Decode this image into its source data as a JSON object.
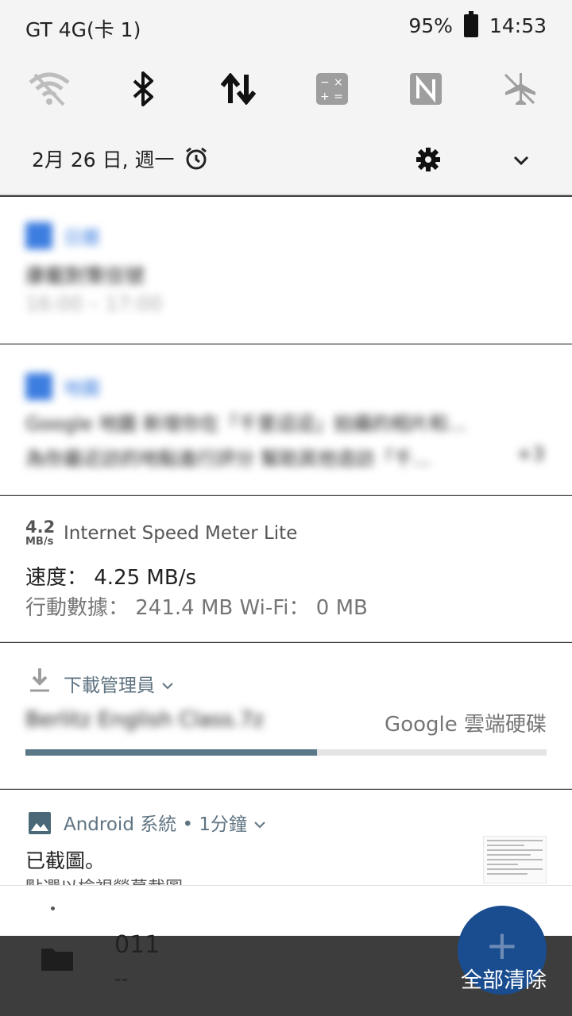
{
  "status_bar": {
    "carrier": "GT 4G(卡 1)",
    "battery": "95%",
    "time": "14:53"
  },
  "quick_settings": {
    "tiles": [
      {
        "icon": "wifi-off-icon"
      },
      {
        "icon": "bluetooth-icon"
      },
      {
        "icon": "data-transfer-icon"
      },
      {
        "icon": "calculator-icon"
      },
      {
        "icon": "nfc-icon"
      },
      {
        "icon": "airplane-mode-icon"
      }
    ],
    "date": "2月 26 日, 週一"
  },
  "notifications": {
    "calendar": {
      "app": "日曆",
      "title": "康載對策信號",
      "time": "16:00 – 17:00"
    },
    "maps": {
      "app": "地圖",
      "line1": "Google 地圖 新增你在「千里迢迢」拍攝的相片和...",
      "line2": "為你最近訪的地點進行評分 幫助其他造訪「千...",
      "more": "+3"
    },
    "speed": {
      "icon_value": "4.2",
      "icon_unit": "MB/s",
      "app": "Internet Speed Meter Lite",
      "speed_line": "速度： 4.25 MB/s",
      "data_line": "行動數據： 241.4 MB   Wi-Fi： 0 MB"
    },
    "download": {
      "app": "下載管理員",
      "file": "Berlitz English Class.7z",
      "destination": "Google 雲端硬碟",
      "progress": 0.56
    },
    "system": {
      "app": "Android 系統 • 1分鐘",
      "title": "已截圖。",
      "text": "點選以檢視螢幕截圖"
    }
  },
  "background_app": {
    "title": "011",
    "subtitle": "--",
    "clear_all": "全部清除",
    "fab": "+"
  }
}
